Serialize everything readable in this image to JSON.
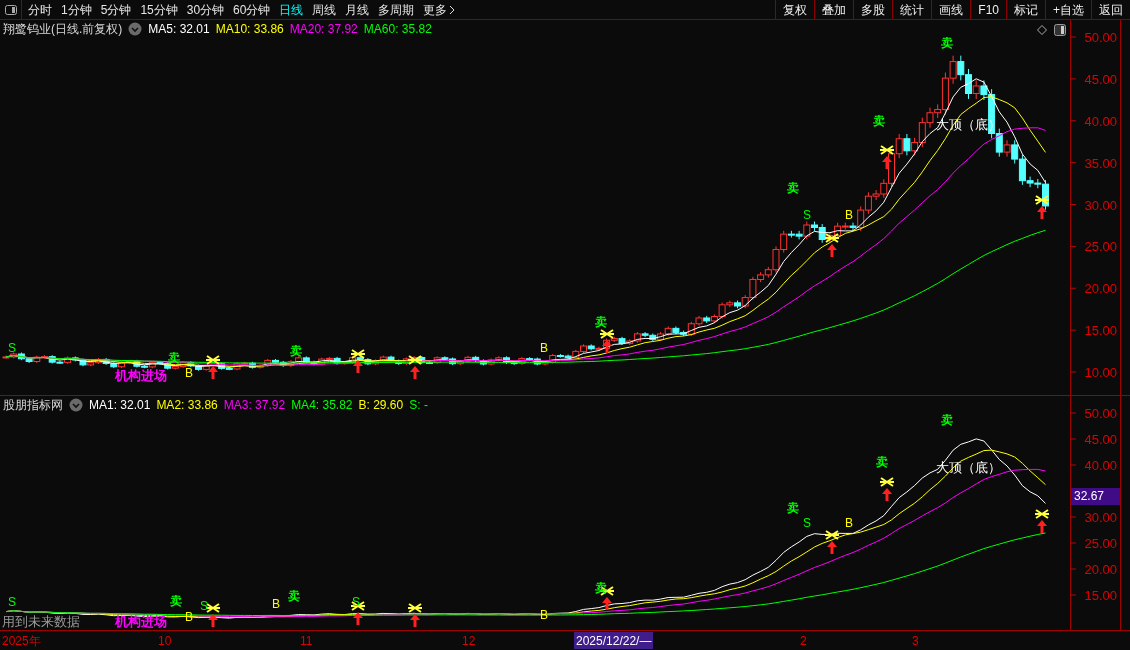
{
  "toolbar": {
    "periods": [
      {
        "label": "分时",
        "selected": false
      },
      {
        "label": "1分钟",
        "selected": false
      },
      {
        "label": "5分钟",
        "selected": false
      },
      {
        "label": "15分钟",
        "selected": false
      },
      {
        "label": "30分钟",
        "selected": false
      },
      {
        "label": "60分钟",
        "selected": false
      },
      {
        "label": "日线",
        "selected": true
      },
      {
        "label": "周线",
        "selected": false
      },
      {
        "label": "月线",
        "selected": false
      },
      {
        "label": "多周期",
        "selected": false
      }
    ],
    "more": "更多",
    "actions": [
      "复权",
      "叠加",
      "多股",
      "统计",
      "画线",
      "F10",
      "标记",
      "+自选",
      "返回"
    ]
  },
  "main_chart": {
    "title": "翔鹭钨业(日线.前复权)",
    "legend": [
      {
        "label": "MA5: 32.01",
        "color": "#ffffff"
      },
      {
        "label": "MA10: 33.86",
        "color": "#ffff00"
      },
      {
        "label": "MA20: 37.92",
        "color": "#ff00ff"
      },
      {
        "label": "MA60: 35.82",
        "color": "#00ff00"
      }
    ],
    "yticks": [
      "50.00",
      "45.00",
      "40.00",
      "35.00",
      "30.00",
      "25.00",
      "20.00",
      "15.00",
      "10.00"
    ],
    "signals": [
      {
        "kind": "sell",
        "text": "卖"
      },
      {
        "kind": "sell",
        "text": "卖"
      },
      {
        "kind": "sell",
        "text": "卖"
      },
      {
        "kind": "sell",
        "text": "卖"
      },
      {
        "kind": "sell",
        "text": "卖"
      },
      {
        "kind": "sell",
        "text": "卖"
      },
      {
        "kind": "s",
        "text": "S"
      },
      {
        "kind": "s",
        "text": "S"
      },
      {
        "kind": "b",
        "text": "B"
      },
      {
        "kind": "b",
        "text": "B"
      },
      {
        "kind": "b",
        "text": "B"
      }
    ],
    "labels": [
      {
        "kind": "top",
        "text": "大顶（底）"
      },
      {
        "kind": "inst",
        "text": "机构进场"
      }
    ]
  },
  "indicator": {
    "title": "股朋指标网",
    "legend": [
      {
        "label": "MA1: 32.01",
        "color": "#ffffff"
      },
      {
        "label": "MA2: 33.86",
        "color": "#ffff00"
      },
      {
        "label": "MA3: 37.92",
        "color": "#ff00ff"
      },
      {
        "label": "MA4: 35.82",
        "color": "#00ff00"
      },
      {
        "label": "B: 29.60",
        "color": "#ffff00"
      },
      {
        "label": "S: -",
        "color": "#00ff00"
      }
    ],
    "yticks": [
      "50.00",
      "45.00",
      "40.00",
      "30.00",
      "25.00",
      "20.00",
      "15.00"
    ],
    "current_value": "32.67",
    "signals": [
      {
        "kind": "sell",
        "text": "卖"
      },
      {
        "kind": "sell",
        "text": "卖"
      },
      {
        "kind": "sell",
        "text": "卖"
      },
      {
        "kind": "sell",
        "text": "卖"
      },
      {
        "kind": "sell",
        "text": "卖"
      },
      {
        "kind": "sell",
        "text": "卖"
      },
      {
        "kind": "s",
        "text": "S"
      },
      {
        "kind": "s",
        "text": "S"
      },
      {
        "kind": "s",
        "text": "S"
      },
      {
        "kind": "s",
        "text": "S"
      },
      {
        "kind": "b",
        "text": "B"
      },
      {
        "kind": "b",
        "text": "B"
      },
      {
        "kind": "b",
        "text": "B"
      },
      {
        "kind": "b",
        "text": "B"
      }
    ],
    "labels": [
      {
        "kind": "top",
        "text": "大顶（底）"
      },
      {
        "kind": "inst",
        "text": "机构进场"
      },
      {
        "kind": "note",
        "text": "用到未来数据"
      }
    ]
  },
  "x_axis": [
    {
      "kind": "label",
      "text": "2025年"
    },
    {
      "kind": "label",
      "text": "10"
    },
    {
      "kind": "label",
      "text": "11"
    },
    {
      "kind": "label",
      "text": "12"
    },
    {
      "kind": "cursor",
      "text": "2025/12/22/—"
    },
    {
      "kind": "label",
      "text": "2"
    },
    {
      "kind": "label",
      "text": "3"
    }
  ]
}
